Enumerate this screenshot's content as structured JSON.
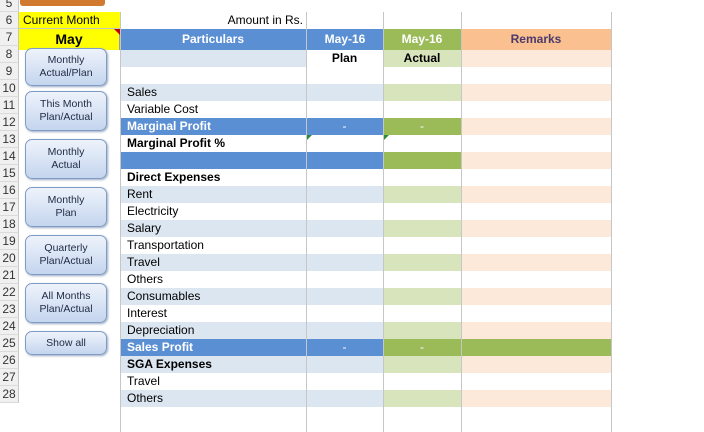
{
  "row_numbers": [
    "5",
    "6",
    "7",
    "8",
    "9",
    "10",
    "11",
    "12",
    "13",
    "14",
    "15",
    "16",
    "17",
    "18",
    "19",
    "20",
    "21",
    "22",
    "23",
    "24",
    "25",
    "26",
    "27",
    "28"
  ],
  "current_month_label": "Current Month",
  "current_month_value": "May",
  "amount_label": "Amount in Rs.",
  "headers": {
    "particulars": "Particulars",
    "plan_month": "May-16",
    "actual_month": "May-16",
    "remarks": "Remarks",
    "plan": "Plan",
    "actual": "Actual"
  },
  "rows": [
    {
      "label": "Sales",
      "type": "item"
    },
    {
      "label": "Variable Cost",
      "type": "item"
    },
    {
      "label": "Marginal Profit",
      "type": "total",
      "plan": "-",
      "actual": "-"
    },
    {
      "label": "Marginal Profit %",
      "type": "bold"
    },
    {
      "label": "",
      "type": "blank-total"
    },
    {
      "label": "Direct Expenses",
      "type": "bold"
    },
    {
      "label": "Rent",
      "type": "item"
    },
    {
      "label": "Electricity",
      "type": "item"
    },
    {
      "label": "Salary",
      "type": "item"
    },
    {
      "label": "Transportation",
      "type": "item"
    },
    {
      "label": "Travel",
      "type": "item"
    },
    {
      "label": "Others",
      "type": "item"
    },
    {
      "label": "Consumables",
      "type": "item"
    },
    {
      "label": "Interest",
      "type": "item"
    },
    {
      "label": "Depreciation",
      "type": "item"
    },
    {
      "label": "Sales Profit",
      "type": "total2",
      "plan": "-",
      "actual": "-"
    },
    {
      "label": "SGA Expenses",
      "type": "bold"
    },
    {
      "label": "Travel",
      "type": "item"
    },
    {
      "label": "Others",
      "type": "item"
    }
  ],
  "buttons": [
    "Monthly\nActual/Plan",
    "This Month\nPlan/Actual",
    "Monthly\nActual",
    "Monthly\nPlan",
    "Quarterly\nPlan/Actual",
    "All Months\nPlan/Actual",
    "Show all"
  ],
  "colors": {
    "header_blue": "#5b8fd4",
    "header_green": "#9bbb59",
    "header_orange": "#fac090",
    "yellow": "#ffff00",
    "band_blue": "#dce6f1",
    "band_green": "#d8e4bc",
    "band_orange": "#fde9d9"
  }
}
